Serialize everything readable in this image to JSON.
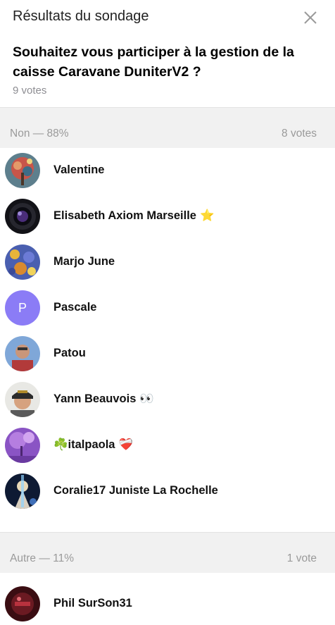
{
  "header": {
    "title": "Résultats du sondage",
    "question": "Souhaitez vous participer à la gestion de la caisse Caravane DuniterV2 ?",
    "total_votes": "9 votes"
  },
  "sections": [
    {
      "label": "Non — 88%",
      "count": "8 votes",
      "voters": [
        {
          "name": "Valentine",
          "emoji": ""
        },
        {
          "name": "Elisabeth Axiom Marseille",
          "emoji": "⭐"
        },
        {
          "name": "Marjo June",
          "emoji": ""
        },
        {
          "name": "Pascale",
          "emoji": "",
          "initial": "P"
        },
        {
          "name": "Patou",
          "emoji": ""
        },
        {
          "name": "Yann Beauvois",
          "emoji": "👀"
        },
        {
          "name": "☘️italpaola",
          "emoji": "❤️‍🩹"
        },
        {
          "name": "Coralie17 Juniste La Rochelle",
          "emoji": ""
        }
      ]
    },
    {
      "label": "Autre — 11%",
      "count": "1 vote",
      "voters": [
        {
          "name": "Phil SurSon31",
          "emoji": ""
        }
      ]
    }
  ],
  "icons": {
    "close": "close-icon",
    "star": "star-emoji",
    "eyes": "eyes-emoji",
    "shamrock": "shamrock-emoji",
    "heart": "mending-heart-emoji"
  },
  "colors": {
    "section_bg": "#f1f1f1",
    "muted_text": "#9a9a9a",
    "pascale_avatar": "#8b7cf6"
  }
}
